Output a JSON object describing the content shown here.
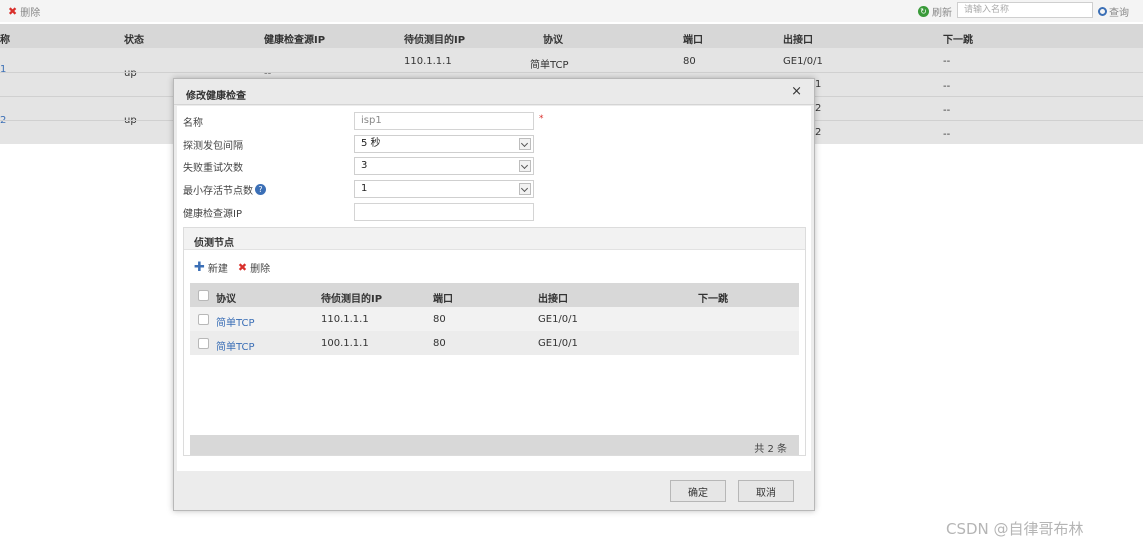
{
  "background": {
    "toolbar": {
      "delete_label": "删除",
      "refresh_label": "刷新",
      "search_placeholder": "请输入名称",
      "query_label": "查询"
    },
    "columns": [
      "称",
      "状态",
      "健康检查源IP",
      "待侦测目的IP",
      "协议",
      "端口",
      "出接口",
      "下一跳"
    ],
    "rows": [
      {
        "name": "1",
        "status": "up",
        "source_ip": "--",
        "dest_ip": "110.1.1.1",
        "protocol": "简单TCP",
        "port": "80",
        "interface": "GE1/0/1",
        "next_hop": "--"
      },
      {
        "interface": "1",
        "next_hop": "--"
      },
      {
        "name": "2",
        "status": "up",
        "interface": "2",
        "next_hop": "--"
      },
      {
        "interface": "2",
        "next_hop": "--"
      }
    ]
  },
  "modal": {
    "title": "修改健康检查",
    "close_glyph": "×",
    "form": {
      "name_label": "名称",
      "name_value": "isp1",
      "required_mark": "*",
      "interval_label": "探测发包间隔",
      "interval_value": "5 秒",
      "retry_label": "失败重试次数",
      "retry_value": "3",
      "min_alive_label": "最小存活节点数",
      "min_alive_value": "1",
      "source_ip_label": "健康检查源IP",
      "source_ip_value": ""
    },
    "probe": {
      "title": "侦测节点",
      "new_label": "新建",
      "delete_label": "删除",
      "columns": [
        "协议",
        "待侦测目的IP",
        "端口",
        "出接口",
        "下一跳"
      ],
      "rows": [
        {
          "protocol": "简单TCP",
          "dest_ip": "110.1.1.1",
          "port": "80",
          "interface": "GE1/0/1",
          "next_hop": ""
        },
        {
          "protocol": "简单TCP",
          "dest_ip": "100.1.1.1",
          "port": "80",
          "interface": "GE1/0/1",
          "next_hop": ""
        }
      ],
      "total_text": "共 2 条"
    },
    "buttons": {
      "ok_label": "确定",
      "cancel_label": "取消"
    }
  },
  "watermark": "CSDN @自律哥布林",
  "colors": {
    "link": "#3b6fb6",
    "delete_icon": "#d9302c",
    "header_bg": "#d7d7d7"
  }
}
